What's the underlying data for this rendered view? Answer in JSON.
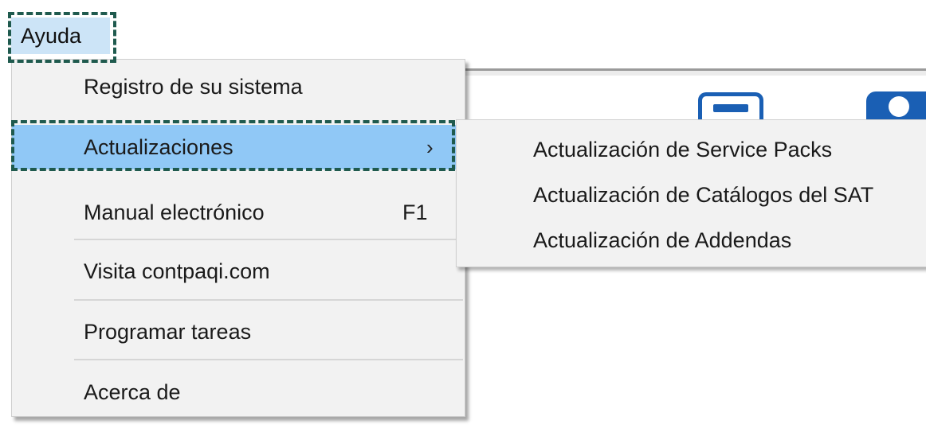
{
  "menubar": {
    "title": "Ayuda"
  },
  "dropdown": {
    "items": [
      {
        "label": "Registro de su sistema"
      },
      {
        "label": "Actualizaciones",
        "arrow": "›"
      },
      {
        "label": "Manual electrónico",
        "shortcut": "F1"
      },
      {
        "label": "Visita contpaqi.com"
      },
      {
        "label": "Programar tareas"
      },
      {
        "label": "Acerca de"
      }
    ]
  },
  "submenu": {
    "items": [
      {
        "label": "Actualización de Service Packs"
      },
      {
        "label": "Actualización de Catálogos del SAT"
      },
      {
        "label": "Actualización de Addendas"
      }
    ]
  },
  "colors": {
    "highlight": "#90c8f6",
    "menu_background": "#f2f2f2",
    "menubar_active": "#cce4f7",
    "callout_border": "#1f5a4e",
    "app_icon_blue": "#1a5fb4"
  },
  "icons": [
    "toolbar-screen-icon",
    "toolbar-user-icon",
    "chevron-right-icon"
  ]
}
